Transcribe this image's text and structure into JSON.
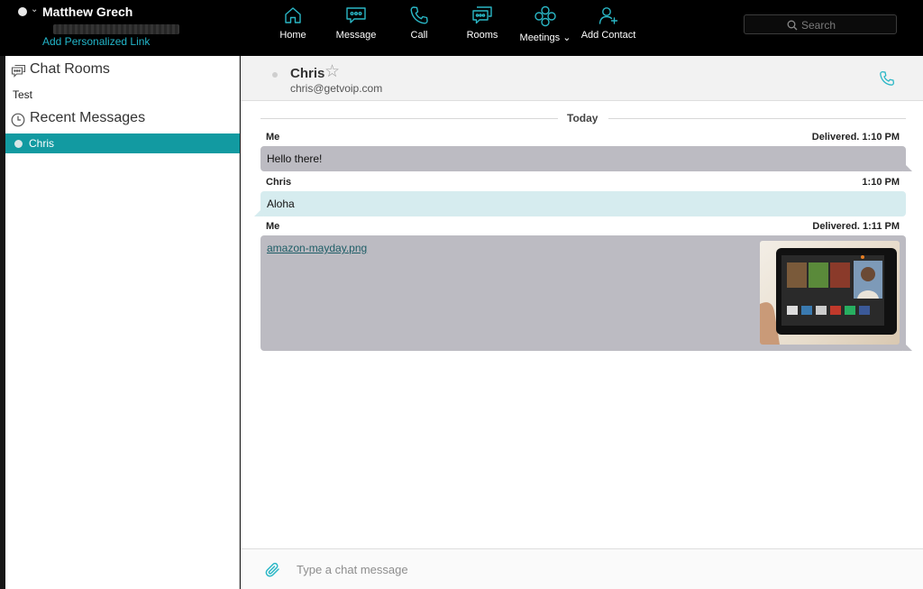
{
  "user": {
    "name": "Matthew Grech",
    "personal_link": "Add Personalized Link"
  },
  "nav": {
    "items": [
      {
        "label": "Home",
        "icon": "home-icon"
      },
      {
        "label": "Message",
        "icon": "message-icon"
      },
      {
        "label": "Call",
        "icon": "phone-icon"
      },
      {
        "label": "Rooms",
        "icon": "rooms-icon"
      },
      {
        "label": "Meetings ⌄",
        "icon": "meetings-icon"
      },
      {
        "label": "Add Contact",
        "icon": "add-contact-icon"
      }
    ]
  },
  "search": {
    "placeholder": "Search"
  },
  "sidebar": {
    "chat_rooms_title": "Chat Rooms",
    "rooms": [
      {
        "label": "Test"
      }
    ],
    "recent_title": "Recent Messages",
    "recent": [
      {
        "label": "Chris"
      }
    ]
  },
  "conversation": {
    "contact_name": "Chris",
    "contact_email": "chris@getvoip.com",
    "day_label": "Today",
    "messages": [
      {
        "sender": "Me",
        "status": "Delivered.  1:10 PM",
        "text": "Hello there!"
      },
      {
        "sender": "Chris",
        "status": "1:10 PM",
        "text": "Aloha"
      },
      {
        "sender": "Me",
        "status": "Delivered.  1:11 PM",
        "file_name": "amazon-mayday.png"
      }
    ]
  },
  "composer": {
    "placeholder": "Type a chat message"
  },
  "colors": {
    "accent": "#129aa1",
    "link": "#22b5c9",
    "bubble_mine": "#bcbbc2",
    "bubble_theirs": "#d6ecef",
    "topbar": "#000000"
  }
}
